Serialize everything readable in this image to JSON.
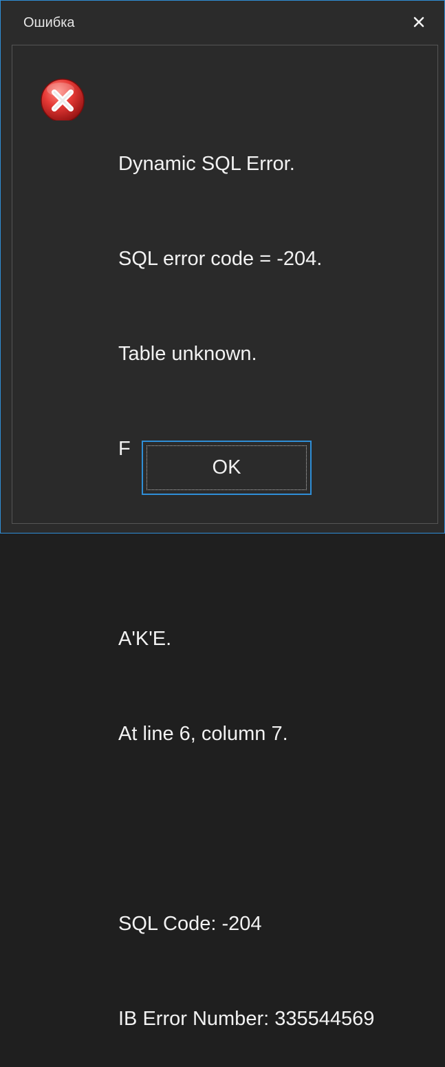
{
  "window": {
    "title": "Ошибка",
    "accent_color": "#2f8fd8",
    "close_icon": "close-icon"
  },
  "dialog": {
    "icon": "error-icon",
    "message_lines": [
      "Dynamic SQL Error.",
      "SQL error code = -204.",
      "Table unknown.",
      "F",
      "",
      "A'K'E.",
      "At line 6, column 7.",
      "",
      "SQL Code: -204",
      "IB Error Number: 335544569"
    ],
    "ok_label": "OK"
  }
}
